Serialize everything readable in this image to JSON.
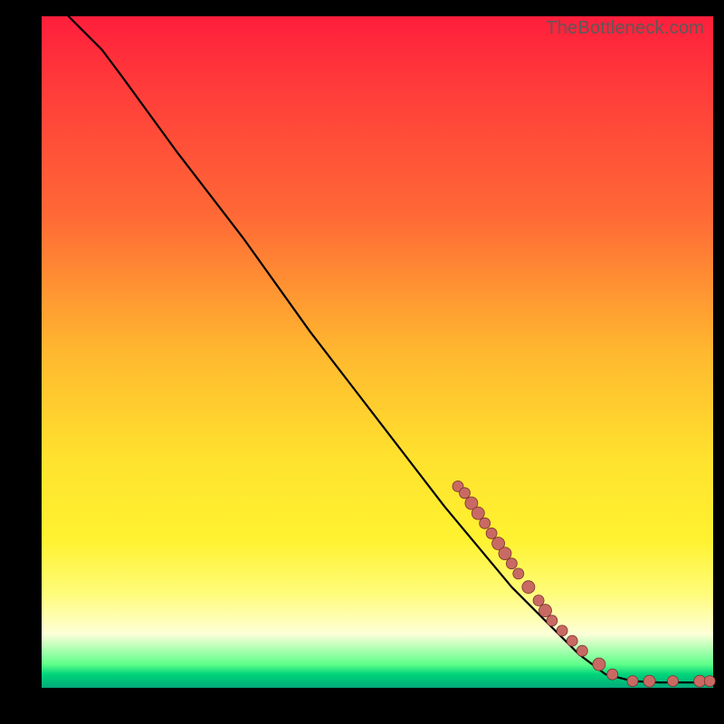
{
  "watermark": "TheBottleneck.com",
  "colors": {
    "dot_fill": "#c86a63",
    "dot_stroke": "#7a322c",
    "curve": "#000000",
    "frame": "#000000"
  },
  "chart_data": {
    "type": "line",
    "title": "",
    "xlabel": "",
    "ylabel": "",
    "xlim": [
      0,
      100
    ],
    "ylim": [
      0,
      100
    ],
    "grid": false,
    "legend": false,
    "curve": [
      {
        "x": 4,
        "y": 100
      },
      {
        "x": 6,
        "y": 98
      },
      {
        "x": 9,
        "y": 95
      },
      {
        "x": 12,
        "y": 91
      },
      {
        "x": 20,
        "y": 80
      },
      {
        "x": 30,
        "y": 67
      },
      {
        "x": 40,
        "y": 53
      },
      {
        "x": 50,
        "y": 40
      },
      {
        "x": 60,
        "y": 27
      },
      {
        "x": 65,
        "y": 21
      },
      {
        "x": 70,
        "y": 15
      },
      {
        "x": 75,
        "y": 10
      },
      {
        "x": 80,
        "y": 5
      },
      {
        "x": 84,
        "y": 2
      },
      {
        "x": 88,
        "y": 1
      },
      {
        "x": 92,
        "y": 0.8
      },
      {
        "x": 100,
        "y": 0.8
      }
    ],
    "series": [
      {
        "name": "markers",
        "points": [
          {
            "x": 62,
            "y": 30,
            "r": 6
          },
          {
            "x": 63,
            "y": 29,
            "r": 6
          },
          {
            "x": 64,
            "y": 27.5,
            "r": 7
          },
          {
            "x": 65,
            "y": 26,
            "r": 7
          },
          {
            "x": 66,
            "y": 24.5,
            "r": 6
          },
          {
            "x": 67,
            "y": 23,
            "r": 6
          },
          {
            "x": 68,
            "y": 21.5,
            "r": 7
          },
          {
            "x": 69,
            "y": 20,
            "r": 7
          },
          {
            "x": 70,
            "y": 18.5,
            "r": 6
          },
          {
            "x": 71,
            "y": 17,
            "r": 6
          },
          {
            "x": 72.5,
            "y": 15,
            "r": 7
          },
          {
            "x": 74,
            "y": 13,
            "r": 6
          },
          {
            "x": 75,
            "y": 11.5,
            "r": 7
          },
          {
            "x": 76,
            "y": 10,
            "r": 6
          },
          {
            "x": 77.5,
            "y": 8.5,
            "r": 6
          },
          {
            "x": 79,
            "y": 7,
            "r": 6
          },
          {
            "x": 80.5,
            "y": 5.5,
            "r": 6
          },
          {
            "x": 83,
            "y": 3.5,
            "r": 7
          },
          {
            "x": 85,
            "y": 2,
            "r": 6
          },
          {
            "x": 88,
            "y": 1,
            "r": 6
          },
          {
            "x": 90.5,
            "y": 1,
            "r": 6.5
          },
          {
            "x": 94,
            "y": 1,
            "r": 6
          },
          {
            "x": 98,
            "y": 1,
            "r": 6.5
          },
          {
            "x": 99.5,
            "y": 1,
            "r": 6
          }
        ]
      }
    ]
  }
}
